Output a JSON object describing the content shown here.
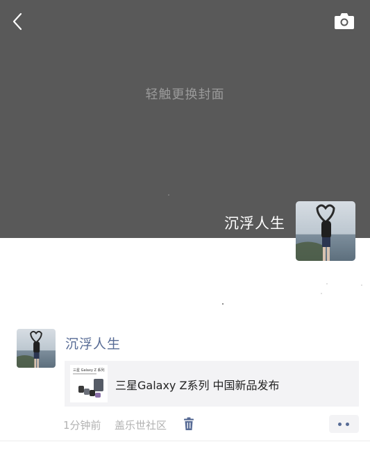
{
  "cover": {
    "hint": "轻触更换封面",
    "profile_name": "沉浮人生"
  },
  "post": {
    "author": "沉浮人生",
    "share": {
      "title": "三星Galaxy Z系列 中国新品发布",
      "thumb_caption": "三星 Galaxy Z 系列"
    },
    "time": "1分钟前",
    "source": "盖乐世社区"
  },
  "icons": {
    "back": "chevron-left-icon",
    "camera": "camera-icon",
    "delete": "trash-icon",
    "more": "more-dots-icon"
  },
  "colors": {
    "cover_bg": "#595959",
    "link": "#576b95",
    "meta": "#b2b2b2",
    "card_bg": "#f3f3f5"
  }
}
